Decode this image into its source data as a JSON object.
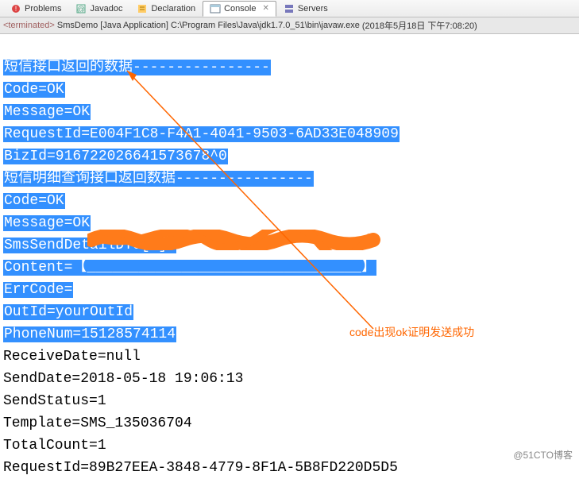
{
  "tabs": {
    "problems": "Problems",
    "javadoc": "Javadoc",
    "declaration": "Declaration",
    "console": "Console",
    "servers": "Servers"
  },
  "status": {
    "terminated": "<terminated>",
    "app_name": "SmsDemo [Java Application]",
    "path": "C:\\Program Files\\Java\\jdk1.7.0_51\\bin\\javaw.exe",
    "timestamp": "(2018年5月18日 下午7:08:20)"
  },
  "console": {
    "lines": [
      {
        "text": "短信接口返回的数据----------------",
        "hl": true
      },
      {
        "text": "Code=OK",
        "hl": true
      },
      {
        "text": "Message=OK",
        "hl": true
      },
      {
        "text": "RequestId=E004F1C8-F4A1-4041-9503-6AD33E048909",
        "hl": true
      },
      {
        "text": "BizId=916722026641573678^0",
        "hl": true
      },
      {
        "text": "短信明细查询接口返回数据----------------",
        "hl": true
      },
      {
        "text": "Code=OK",
        "hl": true
      },
      {
        "text": "Message=OK",
        "hl": true
      },
      {
        "text": "SmsSendDetailDTO[0]:",
        "hl": true
      },
      {
        "text": "Content=【________________________________】",
        "hl": true
      },
      {
        "text": "ErrCode=",
        "hl": true
      },
      {
        "text": "OutId=yourOutId",
        "hl": true
      },
      {
        "text": "PhoneNum=15128574114",
        "hl": true
      },
      {
        "text": "ReceiveDate=null",
        "hl": false
      },
      {
        "text": "SendDate=2018-05-18 19:06:13",
        "hl": false
      },
      {
        "text": "SendStatus=1",
        "hl": false
      },
      {
        "text": "Template=SMS_135036704",
        "hl": false
      },
      {
        "text": "TotalCount=1",
        "hl": false
      },
      {
        "text": "RequestId=89B27EEA-3848-4779-8F1A-5B8FD220D5D5",
        "hl": false
      }
    ]
  },
  "annotation": {
    "note": "code出现ok证明发送成功"
  },
  "watermark": "@51CTO博客"
}
